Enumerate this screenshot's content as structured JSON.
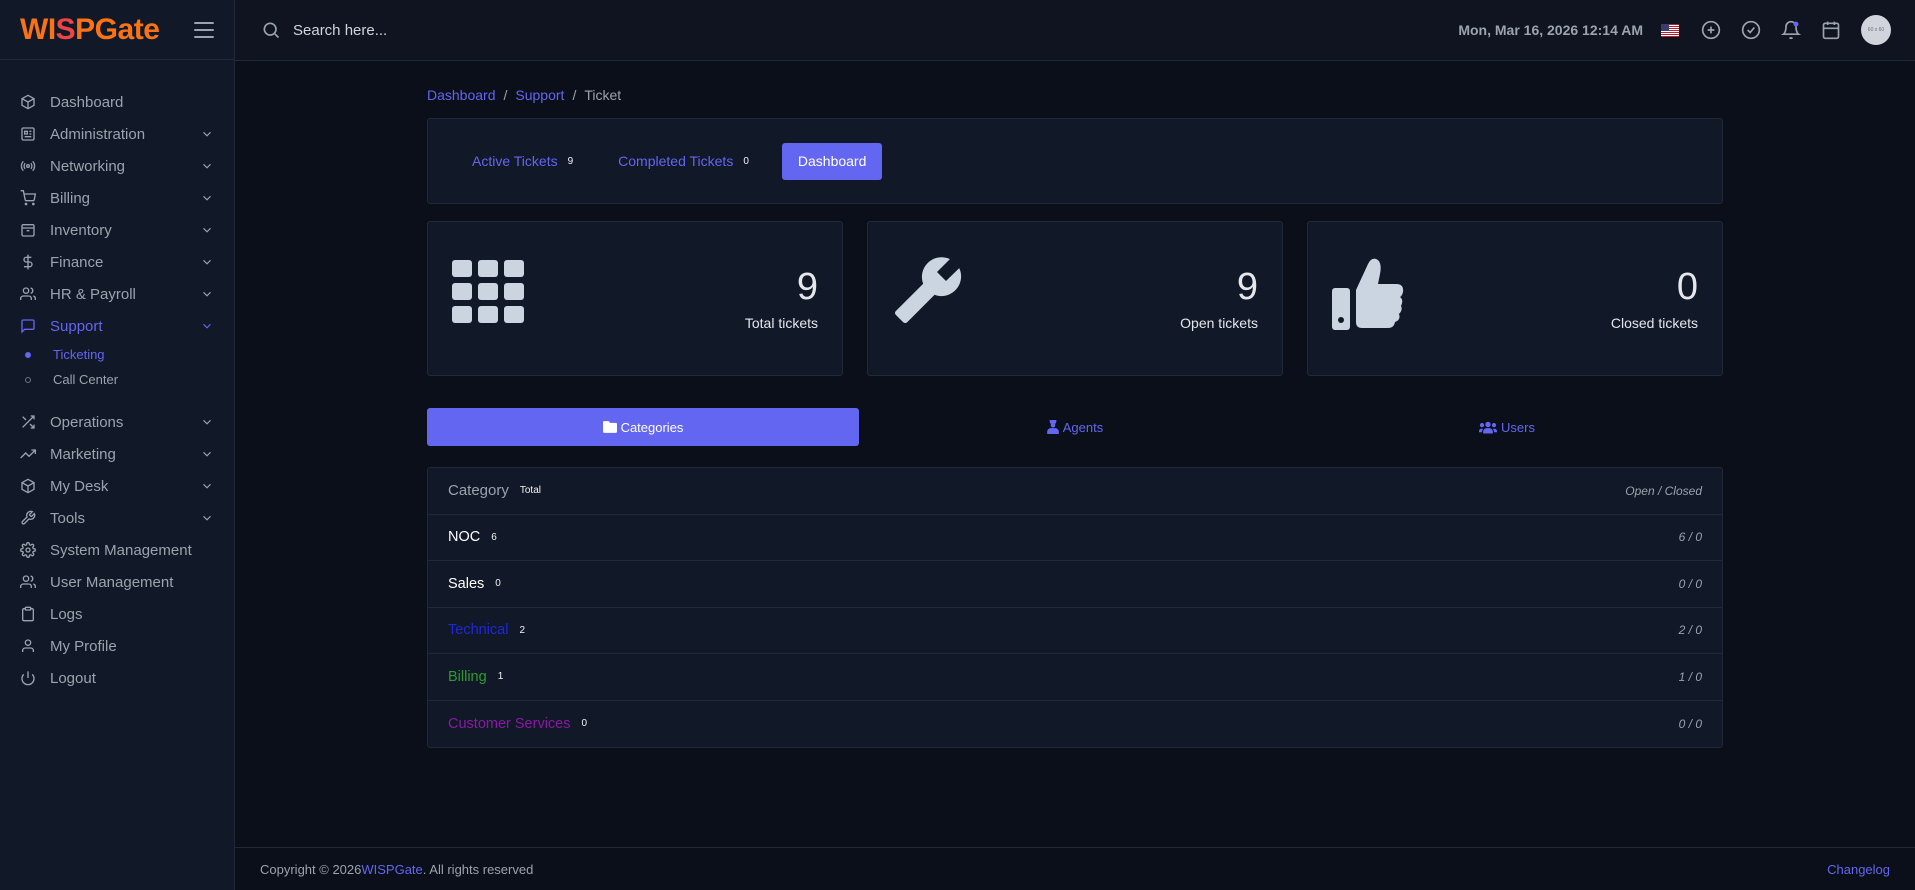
{
  "brand": {
    "logo_prefix": "WI",
    "logo_tower": "S",
    "logo_suffix": "PGate"
  },
  "sidebar": {
    "items": [
      {
        "label": "Dashboard",
        "icon": "cube-icon"
      },
      {
        "label": "Administration",
        "icon": "admin-icon"
      },
      {
        "label": "Networking",
        "icon": "broadcast-icon"
      },
      {
        "label": "Billing",
        "icon": "cart-icon"
      },
      {
        "label": "Inventory",
        "icon": "box-icon"
      },
      {
        "label": "Finance",
        "icon": "dollar-icon"
      },
      {
        "label": "HR & Payroll",
        "icon": "users-icon"
      },
      {
        "label": "Support",
        "icon": "chat-icon"
      },
      {
        "label": "Operations",
        "icon": "shuffle-icon"
      },
      {
        "label": "Marketing",
        "icon": "trending-icon"
      },
      {
        "label": "My Desk",
        "icon": "cube-icon"
      },
      {
        "label": "Tools",
        "icon": "wrench-icon"
      },
      {
        "label": "System Management",
        "icon": "gear-icon"
      },
      {
        "label": "User Management",
        "icon": "users-icon"
      },
      {
        "label": "Logs",
        "icon": "clipboard-icon"
      },
      {
        "label": "My Profile",
        "icon": "user-icon"
      },
      {
        "label": "Logout",
        "icon": "power-icon"
      }
    ],
    "support_sub": [
      {
        "label": "Ticketing"
      },
      {
        "label": "Call Center"
      }
    ]
  },
  "topbar": {
    "search_placeholder": "Search here...",
    "datetime": "Mon, Mar 16, 2026 12:14 AM",
    "avatar_text": "60 x 60"
  },
  "breadcrumb": {
    "home": "Dashboard",
    "section": "Support",
    "current": "Ticket"
  },
  "tabs": {
    "active_label": "Active Tickets",
    "active_count": "9",
    "completed_label": "Completed Tickets",
    "completed_count": "0",
    "dashboard_label": "Dashboard"
  },
  "stats": {
    "total": {
      "value": "9",
      "label": "Total tickets"
    },
    "open": {
      "value": "9",
      "label": "Open tickets"
    },
    "closed": {
      "value": "0",
      "label": "Closed tickets"
    }
  },
  "segments": {
    "categories": "Categories",
    "agents": "Agents",
    "users": "Users"
  },
  "category_table": {
    "head_label": "Category",
    "head_total": "Total",
    "head_oc": "Open / Closed",
    "rows": [
      {
        "name": "NOC",
        "count": "6",
        "oc": "6 / 0",
        "color": "#ffffff"
      },
      {
        "name": "Sales",
        "count": "0",
        "oc": "0 / 0",
        "color": "#ffffff"
      },
      {
        "name": "Technical",
        "count": "2",
        "oc": "2 / 0",
        "color": "#1d28d8"
      },
      {
        "name": "Billing",
        "count": "1",
        "oc": "1 / 0",
        "color": "#2e9b32"
      },
      {
        "name": "Customer Services",
        "count": "0",
        "oc": "0 / 0",
        "color": "#8a1aa3"
      }
    ]
  },
  "footer": {
    "copyright": "Copyright © 2026 ",
    "brand": "WISPGate",
    "rights": ". All rights reserved",
    "changelog": "Changelog"
  },
  "colors": {
    "accent": "#6366f1",
    "logo": "#f97316"
  }
}
